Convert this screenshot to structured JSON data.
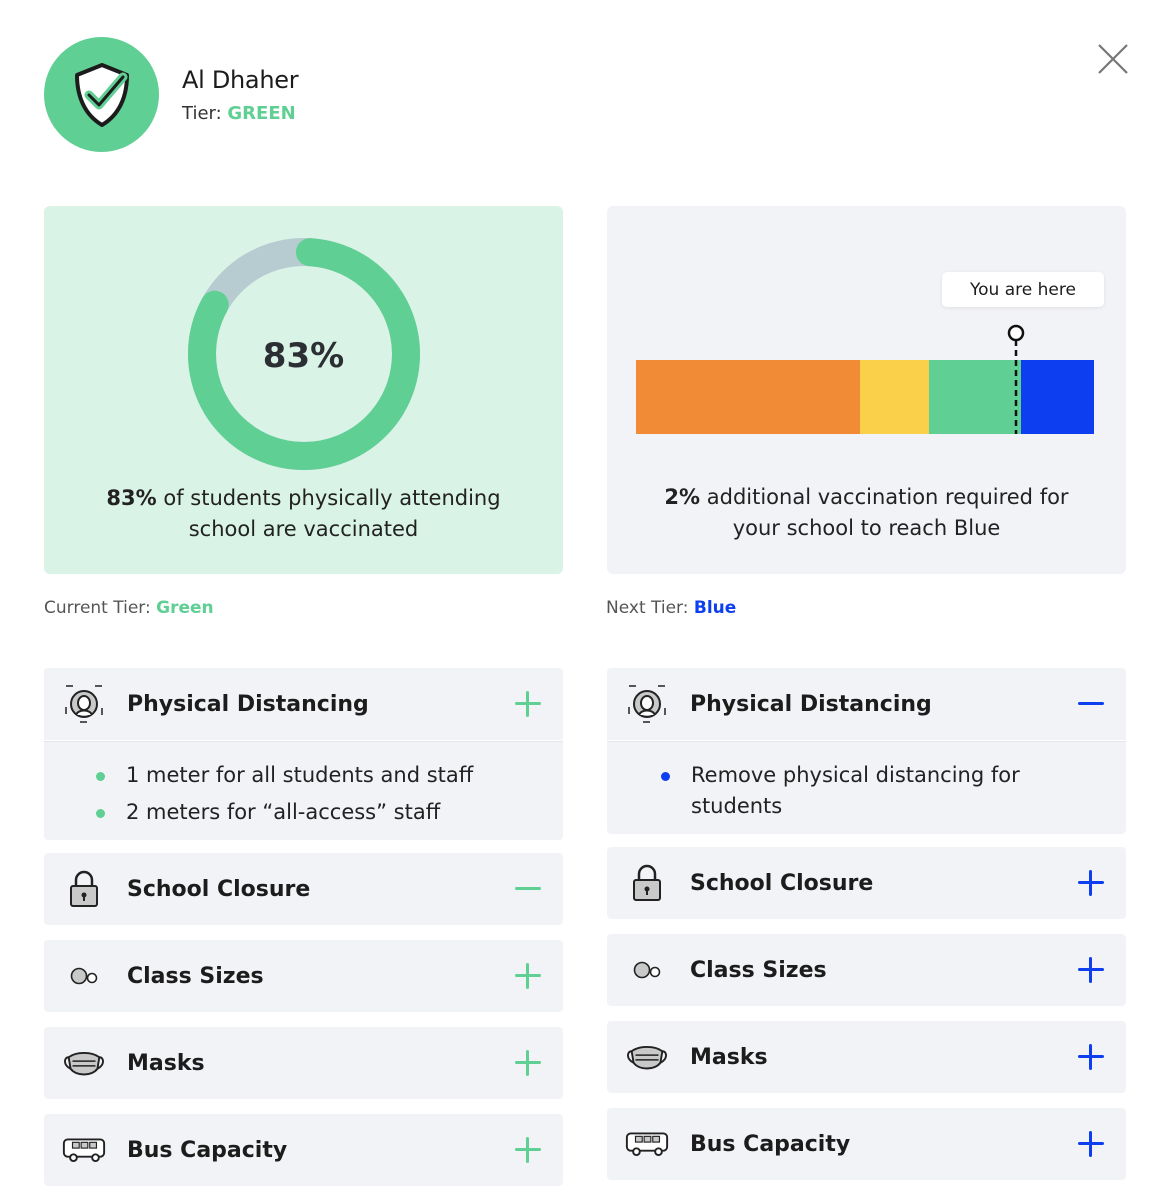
{
  "header": {
    "school_name": "Al Dhaher",
    "tier_prefix": "Tier: ",
    "tier_value": "GREEN"
  },
  "colors": {
    "green": "#5fcf93",
    "blue": "#0d3ff0",
    "orange": "#f28b36",
    "yellow": "#fad04a",
    "ring_remainder": "#b7ccd0"
  },
  "left_card": {
    "percent_text": "83%",
    "vaccinated_fraction": 0.83,
    "caption_bold": "83%",
    "caption_rest": " of students physically attending school are vaccinated"
  },
  "right_card": {
    "marker_label": "You are here",
    "caption_bold": "2%",
    "caption_rest": " additional vaccination required for your school to reach Blue",
    "tier_bar": [
      {
        "tier": "orange",
        "share": 0.49
      },
      {
        "tier": "yellow",
        "share": 0.15
      },
      {
        "tier": "green",
        "share": 0.2
      },
      {
        "tier": "blue",
        "share": 0.16
      }
    ],
    "marker_position_fraction": 0.83
  },
  "current_tier": {
    "prefix": "Current Tier: ",
    "value": "Green"
  },
  "next_tier": {
    "prefix": "Next Tier: ",
    "value": "Blue"
  },
  "left_sections": [
    {
      "title": "Physical Distancing",
      "icon": "distancing-icon",
      "expanded": true,
      "items": [
        "1 meter for all students and staff",
        "2 meters for “all-access” staff"
      ]
    },
    {
      "title": "School Closure",
      "icon": "lock-icon",
      "expanded": true,
      "items": []
    },
    {
      "title": "Class Sizes",
      "icon": "class-size-icon",
      "expanded": false
    },
    {
      "title": "Masks",
      "icon": "mask-icon",
      "expanded": false
    },
    {
      "title": "Bus Capacity",
      "icon": "bus-icon",
      "expanded": false
    }
  ],
  "right_sections": [
    {
      "title": "Physical Distancing",
      "icon": "distancing-icon",
      "expanded": true,
      "items": [
        "Remove physical distancing for students"
      ]
    },
    {
      "title": "School Closure",
      "icon": "lock-icon",
      "expanded": false
    },
    {
      "title": "Class Sizes",
      "icon": "class-size-icon",
      "expanded": false
    },
    {
      "title": "Masks",
      "icon": "mask-icon",
      "expanded": false
    },
    {
      "title": "Bus Capacity",
      "icon": "bus-icon",
      "expanded": false
    }
  ]
}
